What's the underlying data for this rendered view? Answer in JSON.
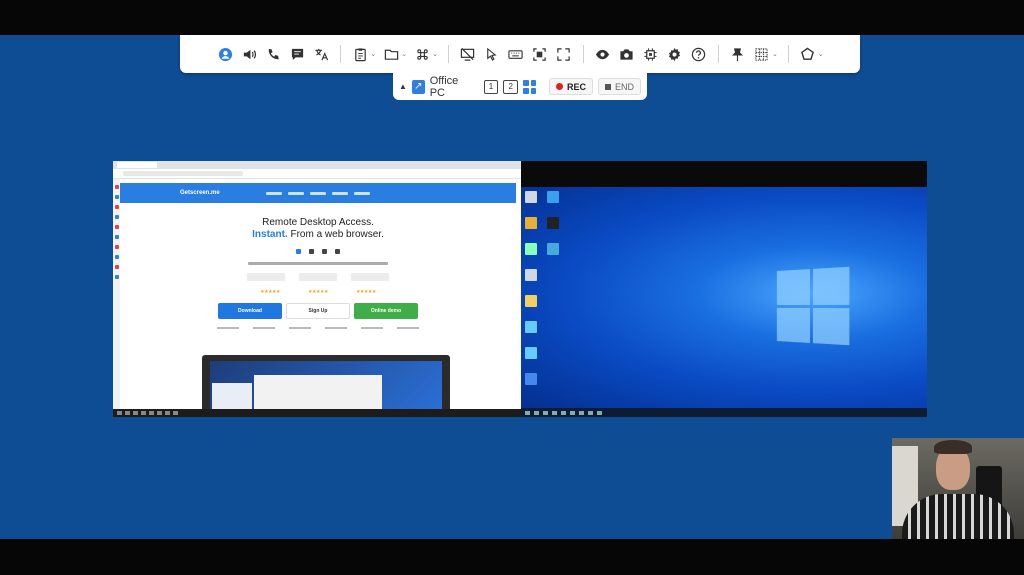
{
  "toolbar": {
    "items": [
      {
        "icon": "user-icon"
      },
      {
        "icon": "speaker-icon"
      },
      {
        "icon": "phone-icon"
      },
      {
        "icon": "chat-icon"
      },
      {
        "icon": "translate-icon"
      },
      {
        "icon": "clipboard-icon"
      },
      {
        "icon": "folder-icon"
      },
      {
        "icon": "command-icon"
      },
      {
        "icon": "monitor-off-icon"
      },
      {
        "icon": "cursor-icon"
      },
      {
        "icon": "keyboard-icon"
      },
      {
        "icon": "fit-screen-icon"
      },
      {
        "icon": "fullscreen-icon"
      },
      {
        "icon": "eye-icon"
      },
      {
        "icon": "camera-icon"
      },
      {
        "icon": "chip-icon"
      },
      {
        "icon": "gear-icon"
      },
      {
        "icon": "help-icon"
      },
      {
        "icon": "pin-icon"
      },
      {
        "icon": "grid-select-icon"
      },
      {
        "icon": "share-icon"
      }
    ]
  },
  "subbar": {
    "computer_name": "Office PC",
    "monitor_1": "1",
    "monitor_2": "2",
    "rec_label": "REC",
    "end_label": "END"
  },
  "left_screen": {
    "site_name": "Getscreen.me",
    "headline_1": "Remote Desktop Access.",
    "headline_2_highlight": "Instant.",
    "headline_2_rest": " From a web browser.",
    "stars": "★★★★★",
    "cta_download": "Download",
    "cta_signup": "Sign Up",
    "cta_demo": "Online demo"
  },
  "colors": {
    "background": "#0e4c94",
    "accent_blue": "#2f7fe0",
    "rec_red": "#e02020",
    "cta_green": "#3fae49"
  }
}
